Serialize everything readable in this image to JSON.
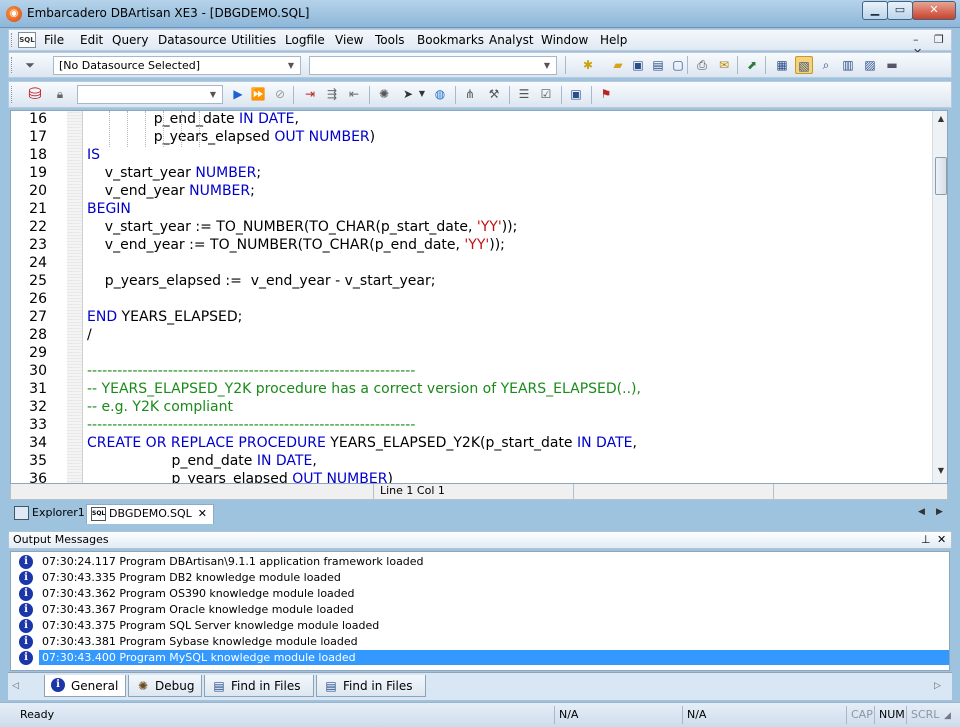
{
  "window": {
    "title": "Embarcadero DBArtisan XE3 - [DBGDEMO.SQL]"
  },
  "menu": [
    "File",
    "Edit",
    "Query",
    "Datasource",
    "Utilities",
    "Logfile",
    "View",
    "Tools",
    "Bookmarks",
    "Analyst",
    "Window",
    "Help"
  ],
  "toolbar": {
    "datasource_selected": "[No Datasource Selected]"
  },
  "editor": {
    "lines": [
      {
        "n": "16",
        "html": "               p_end_date <span class=\"kw\">IN DATE</span>,"
      },
      {
        "n": "17",
        "html": "               p_years_elapsed <span class=\"kw\">OUT NUMBER</span>)"
      },
      {
        "n": "18",
        "html": "<span class=\"kw\">IS</span>"
      },
      {
        "n": "19",
        "html": "    v_start_year <span class=\"kw\">NUMBER</span>;"
      },
      {
        "n": "20",
        "html": "    v_end_year <span class=\"kw\">NUMBER</span>;"
      },
      {
        "n": "21",
        "html": "<span class=\"kw\">BEGIN</span>"
      },
      {
        "n": "22",
        "html": "    v_start_year := TO_NUMBER(TO_CHAR(p_start_date, <span class=\"str\">'YY'</span>));"
      },
      {
        "n": "23",
        "html": "    v_end_year := TO_NUMBER(TO_CHAR(p_end_date, <span class=\"str\">'YY'</span>));"
      },
      {
        "n": "24",
        "html": ""
      },
      {
        "n": "25",
        "html": "    p_years_elapsed :=  v_end_year - v_start_year;"
      },
      {
        "n": "26",
        "html": ""
      },
      {
        "n": "27",
        "html": "<span class=\"kw\">END</span> YEARS_ELAPSED;"
      },
      {
        "n": "28",
        "html": "/"
      },
      {
        "n": "29",
        "html": ""
      },
      {
        "n": "30",
        "html": "<span class=\"cm\">-----------------------------------------------------------------</span>"
      },
      {
        "n": "31",
        "html": "<span class=\"cm\">-- YEARS_ELAPSED_Y2K procedure has a correct version of YEARS_ELAPSED(..),</span>"
      },
      {
        "n": "32",
        "html": "<span class=\"cm\">-- e.g. Y2K compliant</span>"
      },
      {
        "n": "33",
        "html": "<span class=\"cm\">-----------------------------------------------------------------</span>"
      },
      {
        "n": "34",
        "html": "<span class=\"kw\">CREATE OR REPLACE PROCEDURE</span> YEARS_ELAPSED_Y2K(p_start_date <span class=\"kw\">IN DATE</span>,"
      },
      {
        "n": "35",
        "html": "                   p_end_date <span class=\"kw\">IN DATE</span>,"
      },
      {
        "n": "36",
        "html": "                   p_years_elapsed <span class=\"kw\">OUT NUMBER</span>)"
      }
    ],
    "status": {
      "position": "Line 1 Col 1"
    }
  },
  "doc_tabs": [
    {
      "label": "Explorer1",
      "icon": "explorer-icon"
    },
    {
      "label": "DBGDEMO.SQL",
      "icon": "sql-file-icon"
    }
  ],
  "output": {
    "title": "Output Messages",
    "messages": [
      "07:30:24.117 Program  DBArtisan\\9.1.1 application framework loaded",
      "07:30:43.335 Program  DB2 knowledge module loaded",
      "07:30:43.362 Program  OS390 knowledge module loaded",
      "07:30:43.367 Program  Oracle knowledge module loaded",
      "07:30:43.375 Program  SQL Server knowledge module loaded",
      "07:30:43.381 Program  Sybase knowledge module loaded",
      "07:30:43.400 Program  MySQL knowledge module loaded"
    ],
    "selected_index": 6
  },
  "bottom_tabs": [
    "General",
    "Debug",
    "Find in Files 1",
    "Find in Files 2"
  ],
  "statusbar": {
    "ready": "Ready",
    "na1": "N/A",
    "na2": "N/A",
    "cap": "CAP",
    "num": "NUM",
    "scrl": "SCRL"
  },
  "colors": {
    "keyword": "#0000cc",
    "string": "#c01010",
    "comment": "#1a8a1a",
    "selection": "#3399ff"
  }
}
